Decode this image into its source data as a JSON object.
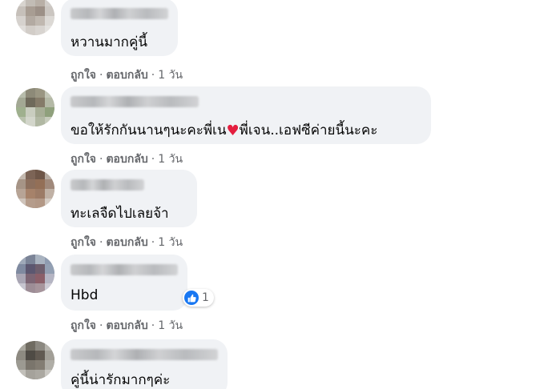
{
  "comments": [
    {
      "text": "หวานมากคู่นี้",
      "like_label": "ถูกใจ",
      "reply_label": "ตอบกลับ",
      "time": "1 วัน"
    },
    {
      "text_before": "ขอให้รักกันนานๆนะคะพี่เน",
      "text_after": "พี่เจน..เอฟซีค่ายนี้นะคะ",
      "heart_icon": "heart-icon",
      "like_label": "ถูกใจ",
      "reply_label": "ตอบกลับ",
      "time": "1 วัน"
    },
    {
      "text": "ทะเลจืดไปเลยจ้า",
      "like_label": "ถูกใจ",
      "reply_label": "ตอบกลับ",
      "time": "1 วัน"
    },
    {
      "text": "Hbd",
      "like_label": "ถูกใจ",
      "reply_label": "ตอบกลับ",
      "time": "1 วัน",
      "reaction": {
        "icon": "thumbs-up-icon",
        "count": "1"
      }
    },
    {
      "text": "คู่นี้น่ารักมากๆค่ะ"
    }
  ],
  "separator": "·",
  "colors": {
    "bubble": "#f0f2f5",
    "secondary_text": "#65676b",
    "like_blue": "#1877f2",
    "heart_red": "#e41e3f"
  }
}
